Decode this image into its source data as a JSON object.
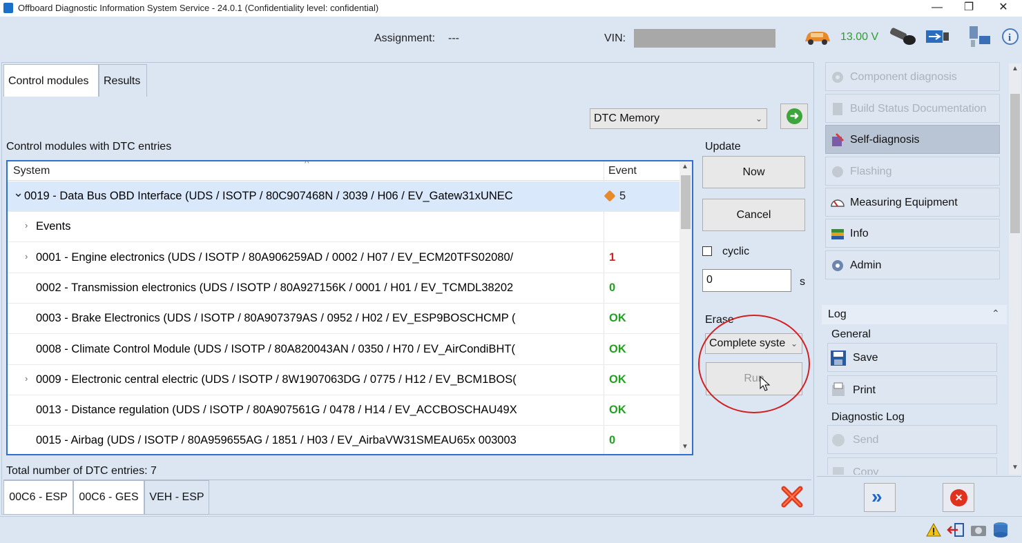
{
  "window": {
    "title": "Offboard Diagnostic Information System Service - 24.0.1 (Confidentiality level: confidential)",
    "minimize_glyph": "—",
    "maximize_glyph": "❐",
    "close_glyph": "✕"
  },
  "header": {
    "assignment_label": "Assignment:",
    "assignment_value": "---",
    "vin_label": "VIN:",
    "voltage": "13.00 V"
  },
  "tabs": [
    {
      "label": "Control modules",
      "active": true
    },
    {
      "label": "Results",
      "active": false
    }
  ],
  "controls": {
    "mode_select_value": "DTC Memory",
    "go_glyph": "➜",
    "section_label": "Control modules with DTC entries",
    "update_label": "Update",
    "now_button": "Now",
    "cancel_button": "Cancel",
    "cyclic_label": "cyclic",
    "interval_value": "0",
    "interval_unit": "s",
    "erase_label": "Erase",
    "erase_select_value": "Complete syste",
    "run_button": "Run"
  },
  "table": {
    "columns": [
      "System",
      "Event"
    ],
    "sort_indicator": "^",
    "rows": [
      {
        "expander": "⌄",
        "system": "0019 - Data Bus OBD Interface  (UDS / ISOTP / 80C907468N / 3039 / H06 / EV_Gatew31xUNEC",
        "event": "5",
        "event_color": "dark",
        "selected": true,
        "indent": 0
      },
      {
        "expander": "›",
        "system": "Events",
        "event": "",
        "event_color": "dark",
        "selected": false,
        "indent": 1
      },
      {
        "expander": "›",
        "system": "0001 - Engine electronics  (UDS / ISOTP / 80A906259AD / 0002 / H07 / EV_ECM20TFS02080/",
        "event": "1",
        "event_color": "red",
        "selected": false,
        "indent": 1
      },
      {
        "expander": "",
        "system": "0002 - Transmission electronics  (UDS / ISOTP / 80A927156K / 0001 / H01 / EV_TCMDL38202",
        "event": "0",
        "event_color": "green",
        "selected": false,
        "indent": 1
      },
      {
        "expander": "",
        "system": "0003 - Brake Electronics  (UDS / ISOTP / 80A907379AS / 0952 / H02 / EV_ESP9BOSCHCMP (",
        "event": "OK",
        "event_color": "green",
        "selected": false,
        "indent": 1
      },
      {
        "expander": "",
        "system": "0008 - Climate Control Module  (UDS / ISOTP / 80A820043AN / 0350 / H70 / EV_AirCondiBHT(",
        "event": "OK",
        "event_color": "green",
        "selected": false,
        "indent": 1
      },
      {
        "expander": "›",
        "system": "0009 - Electronic central electric  (UDS / ISOTP / 8W1907063DG / 0775 / H12 / EV_BCM1BOS(",
        "event": "OK",
        "event_color": "green",
        "selected": false,
        "indent": 1
      },
      {
        "expander": "",
        "system": "0013 - Distance regulation  (UDS / ISOTP / 80A907561G / 0478 / H14 / EV_ACCBOSCHAU49X",
        "event": "OK",
        "event_color": "green",
        "selected": false,
        "indent": 1
      },
      {
        "expander": "",
        "system": "0015 - Airbag  (UDS / ISOTP / 80A959655AG / 1851 / H03 / EV_AirbaVW31SMEAU65x 003003",
        "event": "0",
        "event_color": "green",
        "selected": false,
        "indent": 1
      }
    ]
  },
  "total_label": "Total number of DTC entries: 7",
  "bottom_tabs": [
    "00C6 - ESP",
    "00C6 - GES",
    "VEH - ESP"
  ],
  "nav": [
    {
      "label": "Component diagnosis",
      "state": "disabled",
      "icon": "gear-icon"
    },
    {
      "label": "Build Status Documentation",
      "state": "disabled",
      "icon": "document-icon"
    },
    {
      "label": "Self-diagnosis",
      "state": "active",
      "icon": "diagnosis-icon"
    },
    {
      "label": "Flashing",
      "state": "disabled",
      "icon": "flash-icon"
    },
    {
      "label": "Measuring Equipment",
      "state": "normal",
      "icon": "gauge-icon"
    },
    {
      "label": "Info",
      "state": "normal",
      "icon": "books-icon"
    },
    {
      "label": "Admin",
      "state": "normal",
      "icon": "admin-gear-icon"
    }
  ],
  "log": {
    "title": "Log",
    "collapse_glyph": "⌃",
    "general_label": "General",
    "save_button": "Save",
    "print_button": "Print",
    "diag_label": "Diagnostic Log",
    "send_button": "Send",
    "copy_button": "Copy"
  },
  "bottom_actions": {
    "forward_glyph": "»",
    "close_glyph": "✕"
  },
  "colors": {
    "accent_blue": "#2f6fd0",
    "ok_green": "#22a022",
    "error_red": "#d42020",
    "annotation_red": "#d02020"
  }
}
